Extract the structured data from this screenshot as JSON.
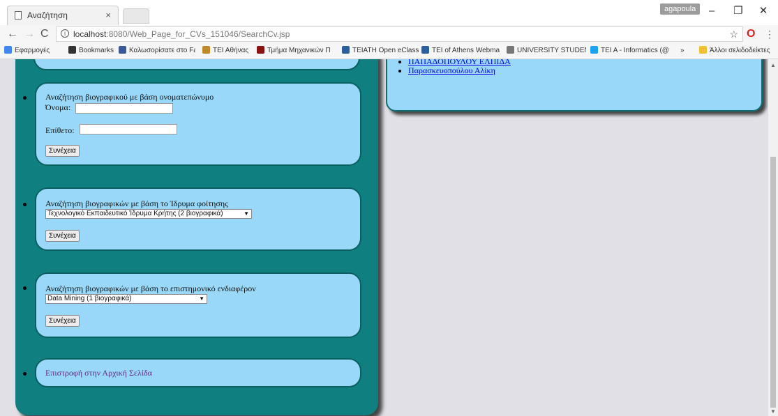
{
  "browser": {
    "tab_title": "Αναζήτηση",
    "tab_close": "×",
    "user_badge": "agapoula",
    "win_minimize": "–",
    "win_restore": "❐",
    "win_close": "✕",
    "url_host": "localhost",
    "url_path": ":8080/Web_Page_for_CVs_151046/SearchCv.jsp",
    "bookmarks": [
      {
        "label": "Εφαρμογές",
        "icon_color": "#4285f4"
      },
      {
        "label": "Bookmarks",
        "icon_color": "#333333"
      },
      {
        "label": "Καλωσορίσατε στο Fa",
        "icon_color": "#3b5998"
      },
      {
        "label": "ΤΕΙ Αθήνας",
        "icon_color": "#c08a2a"
      },
      {
        "label": "Τμήμα Μηχανικών Π",
        "icon_color": "#8b1010"
      },
      {
        "label": "TEIATH Open eClass",
        "icon_color": "#2c5f9e"
      },
      {
        "label": "TEI of Athens Webma",
        "icon_color": "#2c5f9e"
      },
      {
        "label": "UNIVERSITY STUDENT",
        "icon_color": "#777777"
      },
      {
        "label": "TEI A - Informatics (@",
        "icon_color": "#1da1f2"
      }
    ],
    "bookmarks_more": "»",
    "other_bookmarks": "Άλλοι σελιδοδείκτες"
  },
  "results": {
    "items": [
      "ΠΑΠΑΔΟΠΟΥΛΟΥ ΕΛΠΙΔΑ",
      "Παρασκευοπούλου Αλίκη"
    ]
  },
  "search_by_name": {
    "heading": "Αναζήτηση βιογραφικού με βάση ονοματεπώνυμο",
    "first_name_label": "Όνομα:",
    "last_name_label": "Επίθετο:",
    "submit": "Συνέχεια"
  },
  "search_by_institution": {
    "heading": "Αναζήτηση βιογραφικών με βάση το Ίδρυμα φοίτησης",
    "selected": "Τεχνολογικό Εκπαιδευτικό Ίδρυμα Κρήτης (2 βιογραφικά)",
    "submit": "Συνέχεια"
  },
  "search_by_interest": {
    "heading": "Αναζήτηση βιογραφικών με βάση το επιστημονικό ενδιαφέρον",
    "selected": "Data Mining (1 βιογραφικά)",
    "submit": "Συνέχεια"
  },
  "home_link": "Επιστροφή στην Αρχική Σελίδα",
  "colors": {
    "panel": "#0f7f80",
    "card": "#99d8f8",
    "page_bg": "#e0e0e6"
  }
}
